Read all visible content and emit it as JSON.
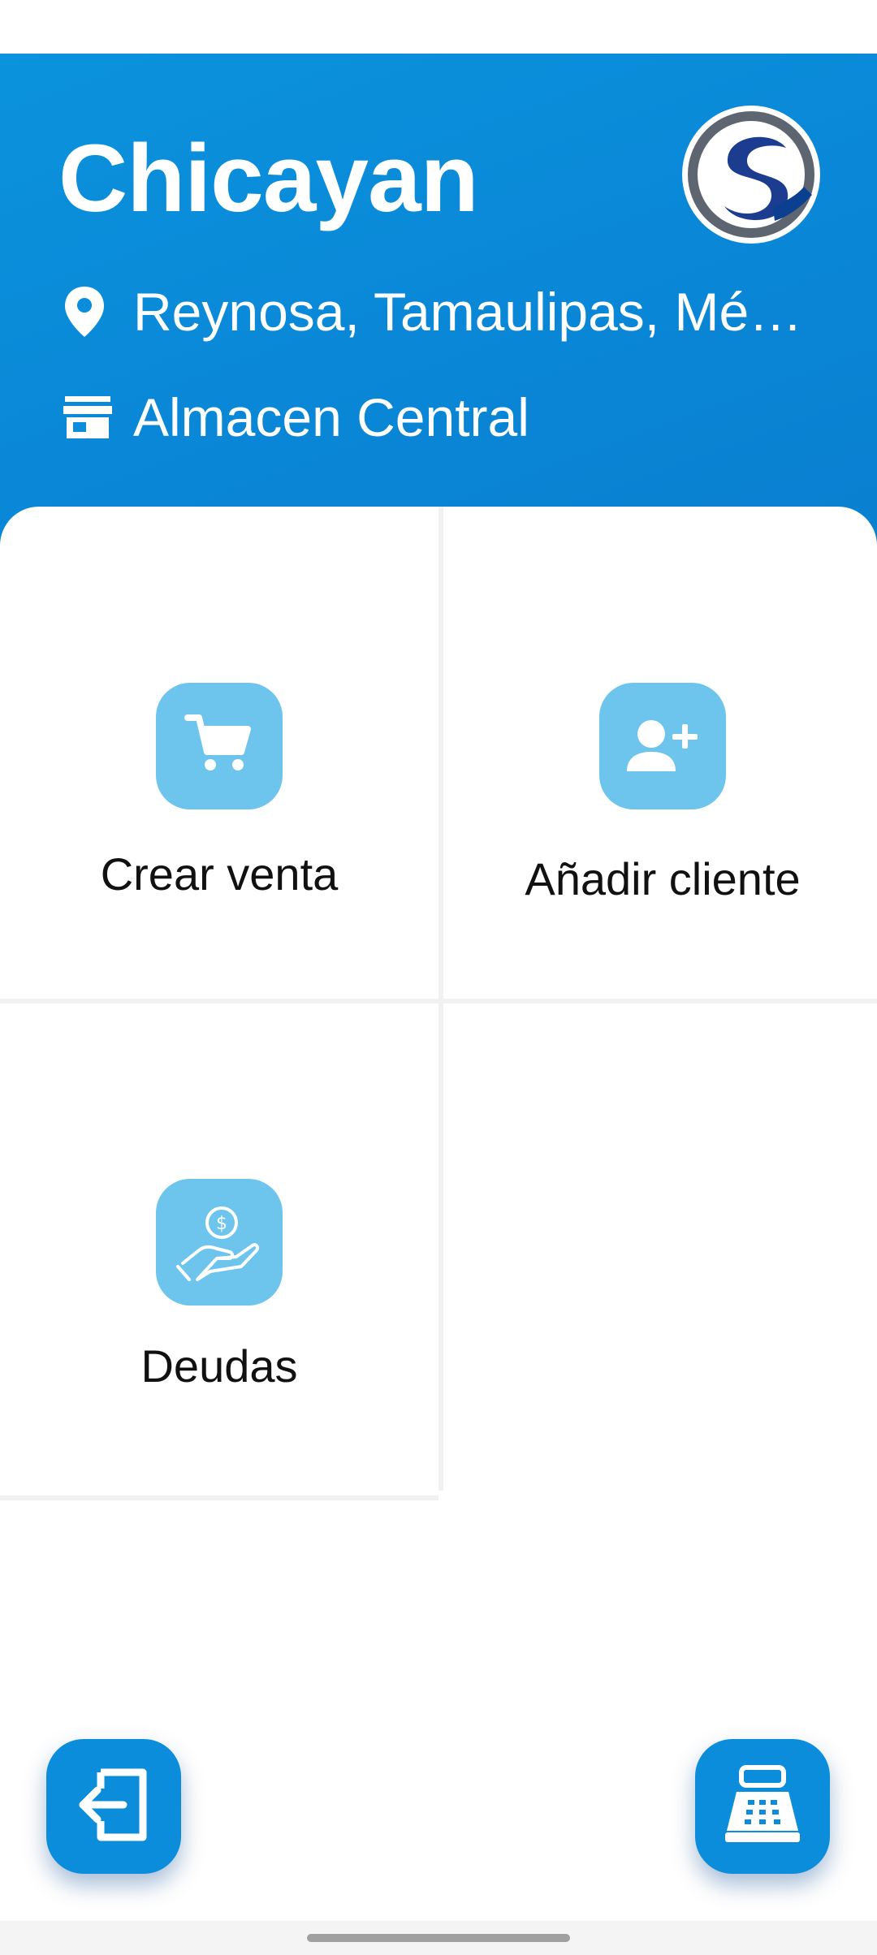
{
  "header": {
    "title": "Chicayan",
    "location": "Reynosa, Tamaulipas, México",
    "warehouse": "Almacen Central",
    "logo_icon": "brand-s-logo",
    "location_icon": "map-pin-icon",
    "warehouse_icon": "storefront-icon",
    "background_color": "#0b8ddb"
  },
  "tiles": [
    {
      "label": "Crear venta",
      "icon": "shopping-cart-icon"
    },
    {
      "label": "Añadir cliente",
      "icon": "add-user-icon"
    },
    {
      "label": "Deudas",
      "icon": "hand-coin-icon"
    }
  ],
  "fabs": {
    "logout_icon": "logout-icon",
    "register_icon": "cash-register-icon"
  },
  "colors": {
    "accent": "#0b8ddb",
    "tile_badge": "#6dc4ec"
  }
}
